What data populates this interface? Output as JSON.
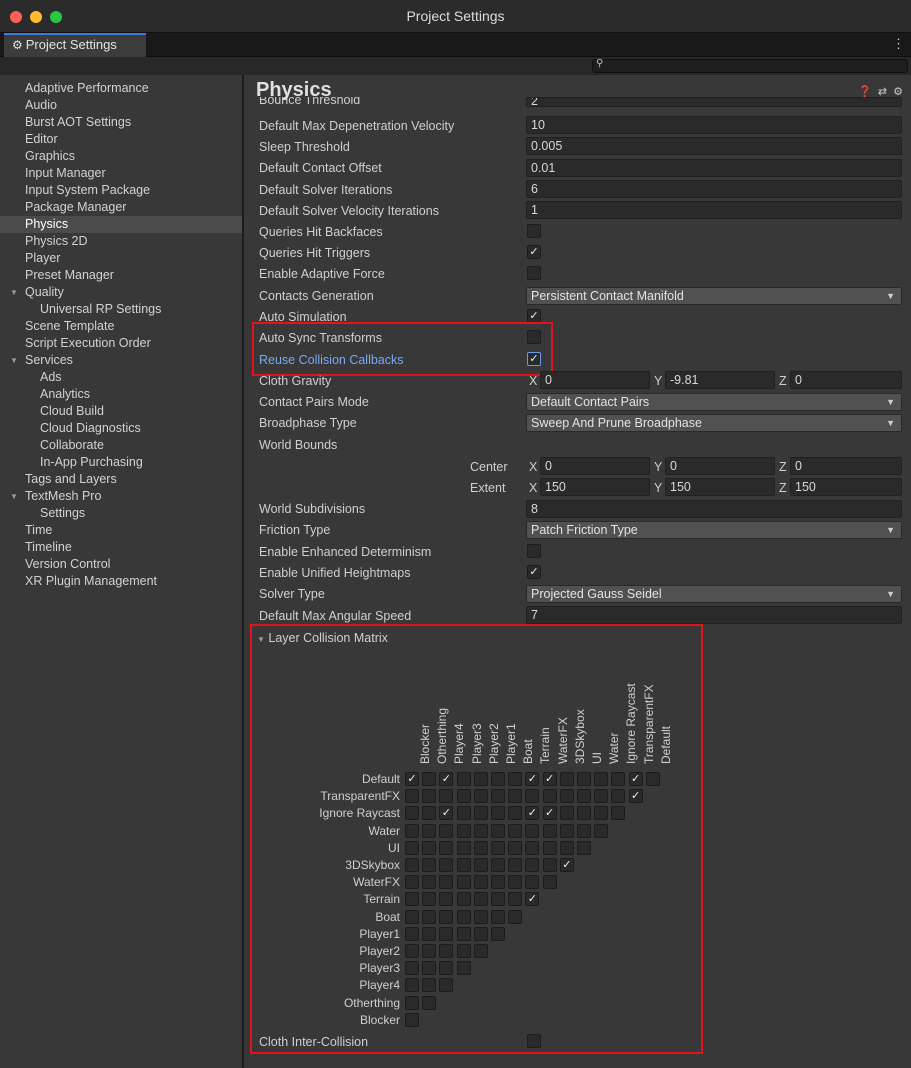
{
  "window": {
    "title": "Project Settings"
  },
  "tab": {
    "label": "Project Settings",
    "icon": "gear-icon",
    "menu_icon": "vertical-ellipsis-icon"
  },
  "search": {
    "placeholder": "",
    "icon": "search-icon"
  },
  "sidebar": {
    "items": [
      {
        "label": "Adaptive Performance"
      },
      {
        "label": "Audio"
      },
      {
        "label": "Burst AOT Settings"
      },
      {
        "label": "Editor"
      },
      {
        "label": "Graphics"
      },
      {
        "label": "Input Manager"
      },
      {
        "label": "Input System Package"
      },
      {
        "label": "Package Manager"
      },
      {
        "label": "Physics",
        "selected": true
      },
      {
        "label": "Physics 2D"
      },
      {
        "label": "Player"
      },
      {
        "label": "Preset Manager"
      },
      {
        "label": "Quality",
        "expanded": true
      },
      {
        "label": "Universal RP Settings"
      },
      {
        "label": "Scene Template"
      },
      {
        "label": "Script Execution Order"
      },
      {
        "label": "Services",
        "expanded": true
      },
      {
        "label": "Ads"
      },
      {
        "label": "Analytics"
      },
      {
        "label": "Cloud Build"
      },
      {
        "label": "Cloud Diagnostics"
      },
      {
        "label": "Collaborate"
      },
      {
        "label": "In-App Purchasing"
      },
      {
        "label": "Tags and Layers"
      },
      {
        "label": "TextMesh Pro",
        "expanded": true
      },
      {
        "label": "Settings"
      },
      {
        "label": "Time"
      },
      {
        "label": "Timeline"
      },
      {
        "label": "Version Control"
      },
      {
        "label": "XR Plugin Management"
      }
    ]
  },
  "physics": {
    "title": "Physics",
    "header_icons": [
      "help-icon",
      "preset-icon",
      "settings-icon"
    ],
    "bounce_threshold": {
      "label": "Bounce Threshold",
      "value": "2"
    },
    "max_depenetration": {
      "label": "Default Max Depenetration Velocity",
      "value": "10"
    },
    "sleep_threshold": {
      "label": "Sleep Threshold",
      "value": "0.005"
    },
    "contact_offset": {
      "label": "Default Contact Offset",
      "value": "0.01"
    },
    "solver_iterations": {
      "label": "Default Solver Iterations",
      "value": "6"
    },
    "solver_velocity_iterations": {
      "label": "Default Solver Velocity Iterations",
      "value": "1"
    },
    "queries_hit_backfaces": {
      "label": "Queries Hit Backfaces",
      "checked": false
    },
    "queries_hit_triggers": {
      "label": "Queries Hit Triggers",
      "checked": true
    },
    "adaptive_force": {
      "label": "Enable Adaptive Force",
      "checked": false
    },
    "contacts_generation": {
      "label": "Contacts Generation",
      "value": "Persistent Contact Manifold"
    },
    "auto_simulation": {
      "label": "Auto Simulation",
      "checked": true
    },
    "auto_sync_transforms": {
      "label": "Auto Sync Transforms",
      "checked": false
    },
    "reuse_collision_callbacks": {
      "label": "Reuse Collision Callbacks",
      "checked": true
    },
    "cloth_gravity": {
      "label": "Cloth Gravity",
      "x_label": "X",
      "x": "0",
      "y_label": "Y",
      "y": "-9.81",
      "z_label": "Z",
      "z": "0"
    },
    "contact_pairs_mode": {
      "label": "Contact Pairs Mode",
      "value": "Default Contact Pairs"
    },
    "broadphase_type": {
      "label": "Broadphase Type",
      "value": "Sweep And Prune Broadphase"
    },
    "world_bounds": {
      "label": "World Bounds",
      "center": {
        "label": "Center",
        "x_label": "X",
        "x": "0",
        "y_label": "Y",
        "y": "0",
        "z_label": "Z",
        "z": "0"
      },
      "extent": {
        "label": "Extent",
        "x_label": "X",
        "x": "150",
        "y_label": "Y",
        "y": "150",
        "z_label": "Z",
        "z": "150"
      }
    },
    "world_subdivisions": {
      "label": "World Subdivisions",
      "value": "8"
    },
    "friction_type": {
      "label": "Friction Type",
      "value": "Patch Friction Type"
    },
    "enhanced_determinism": {
      "label": "Enable Enhanced Determinism",
      "checked": false
    },
    "unified_heightmaps": {
      "label": "Enable Unified Heightmaps",
      "checked": true
    },
    "solver_type": {
      "label": "Solver Type",
      "value": "Projected Gauss Seidel"
    },
    "max_angular_speed": {
      "label": "Default Max Angular Speed",
      "value": "7"
    },
    "layer_matrix": {
      "label": "Layer Collision Matrix",
      "layers": [
        "Default",
        "TransparentFX",
        "Ignore Raycast",
        "Water",
        "UI",
        "3DSkybox",
        "WaterFX",
        "Terrain",
        "Boat",
        "Player1",
        "Player2",
        "Player3",
        "Player4",
        "Otherthing",
        "Blocker"
      ],
      "checked": [
        [
          0,
          0
        ],
        [
          0,
          2
        ],
        [
          0,
          7
        ],
        [
          0,
          8
        ],
        [
          0,
          13
        ],
        [
          1,
          13
        ],
        [
          2,
          2
        ],
        [
          2,
          7
        ],
        [
          2,
          8
        ],
        [
          2,
          13
        ],
        [
          3,
          13
        ],
        [
          4,
          13
        ],
        [
          5,
          9
        ],
        [
          5,
          10
        ],
        [
          5,
          11
        ],
        [
          5,
          12
        ],
        [
          5,
          13
        ],
        [
          6,
          13
        ],
        [
          7,
          7
        ],
        [
          7,
          8
        ],
        [
          7,
          13
        ],
        [
          8,
          8
        ],
        [
          8,
          13
        ],
        [
          9,
          13
        ],
        [
          10,
          13
        ],
        [
          11,
          13
        ],
        [
          12,
          13
        ],
        [
          13,
          13
        ],
        [
          13,
          14
        ]
      ]
    },
    "cloth_inter_collision": {
      "label": "Cloth Inter-Collision",
      "checked": false
    }
  },
  "colors": {
    "accent": "#3a79d6",
    "highlight_box": "#e0141a",
    "selected_label": "#79a8f0"
  }
}
